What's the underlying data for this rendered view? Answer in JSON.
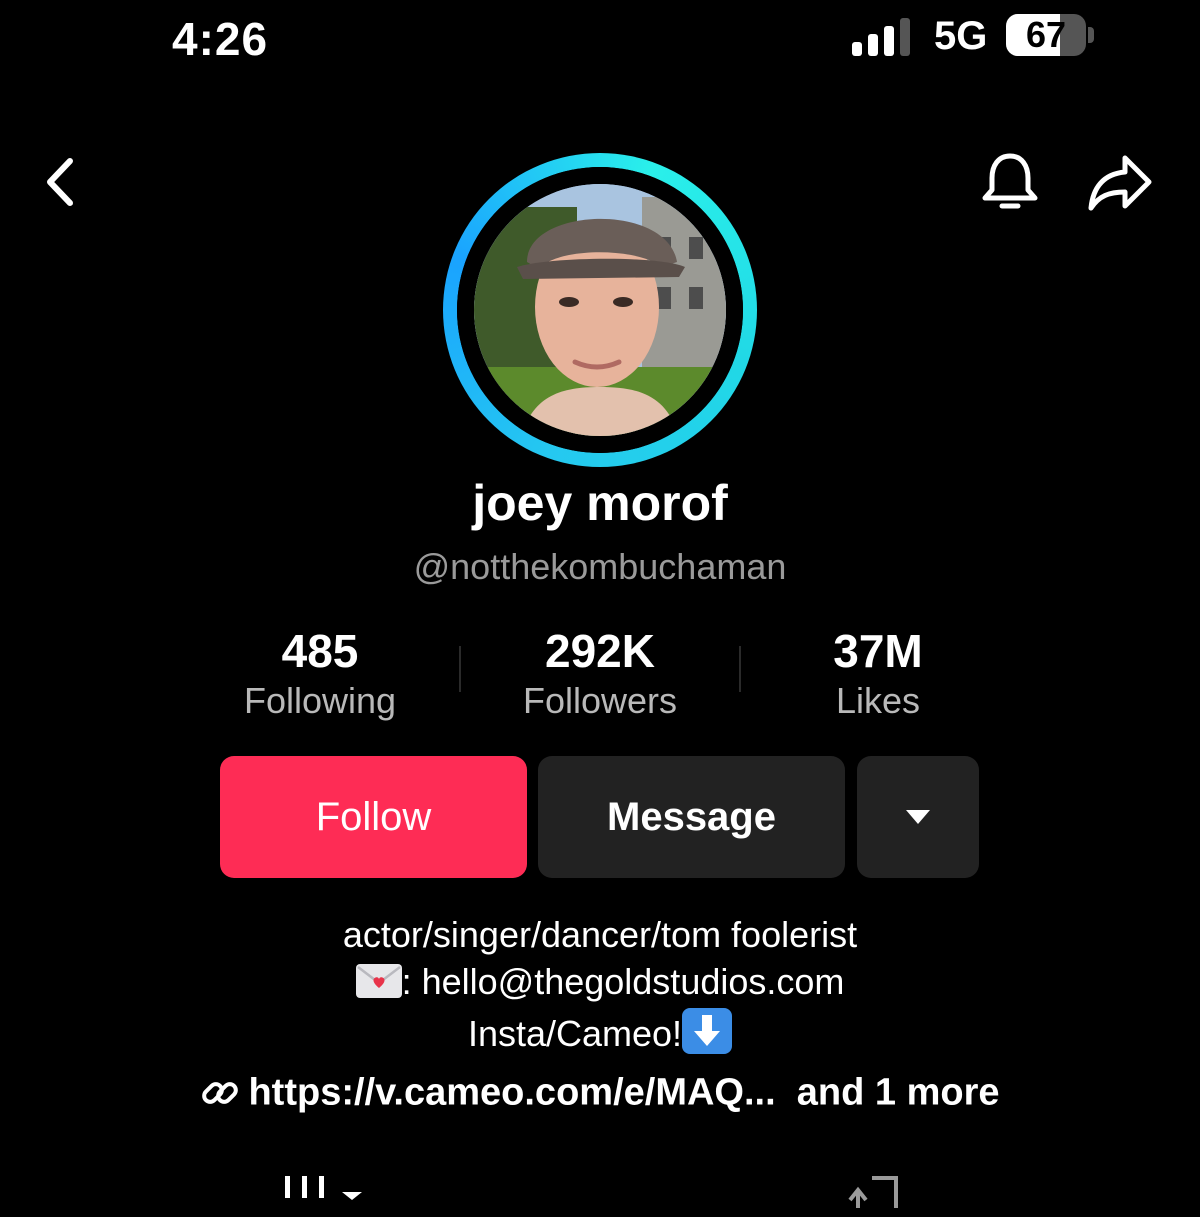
{
  "status_bar": {
    "time": "4:26",
    "network": "5G",
    "battery": "67",
    "battery_level": 0.67,
    "signal_bars": 3,
    "signal_max": 4
  },
  "profile": {
    "display_name": "joey morof",
    "handle": "@notthekombuchaman"
  },
  "stats": [
    {
      "value": "485",
      "label": "Following"
    },
    {
      "value": "292K",
      "label": "Followers"
    },
    {
      "value": "37M",
      "label": "Likes"
    }
  ],
  "actions": {
    "follow_label": "Follow",
    "message_label": "Message"
  },
  "bio": {
    "line1": "actor/singer/dancer/tom foolerist",
    "line2_text": ": hello@thegoldstudios.com",
    "line3_text": "Insta/Cameo!"
  },
  "link": {
    "url": "https://v.cameo.com/e/MAQ...",
    "more": "and 1 more"
  },
  "colors": {
    "accent": "#fe2c55",
    "ring_cyan": "#25c8f0",
    "secondary_button": "#222222",
    "muted_text": "#9a9a9a"
  },
  "icons": [
    "back-chevron-icon",
    "bell-icon",
    "share-arrow-icon",
    "dropdown-caret-icon",
    "love-letter-icon",
    "down-arrow-icon",
    "link-icon",
    "videos-grid-icon",
    "repost-icon"
  ]
}
